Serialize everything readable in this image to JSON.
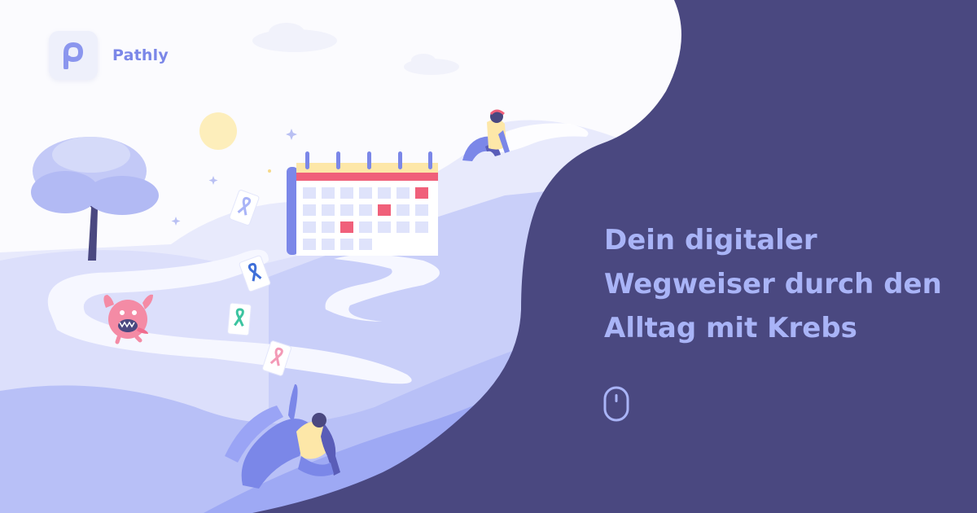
{
  "brand": {
    "name": "Pathly",
    "logo_icon": "pathly-p-logo-icon"
  },
  "hero": {
    "headline_lines": [
      "Dein digitaler",
      "Wegweiser durch den",
      "Alltag mit Krebs"
    ]
  },
  "scroll_indicator": {
    "icon": "mouse-icon"
  },
  "colors": {
    "panel": "#4a4880",
    "accent": "#a9b4f7",
    "brand": "#7b87e8",
    "calendar_highlight": "#f0607a",
    "hills": "#c9cff9"
  }
}
